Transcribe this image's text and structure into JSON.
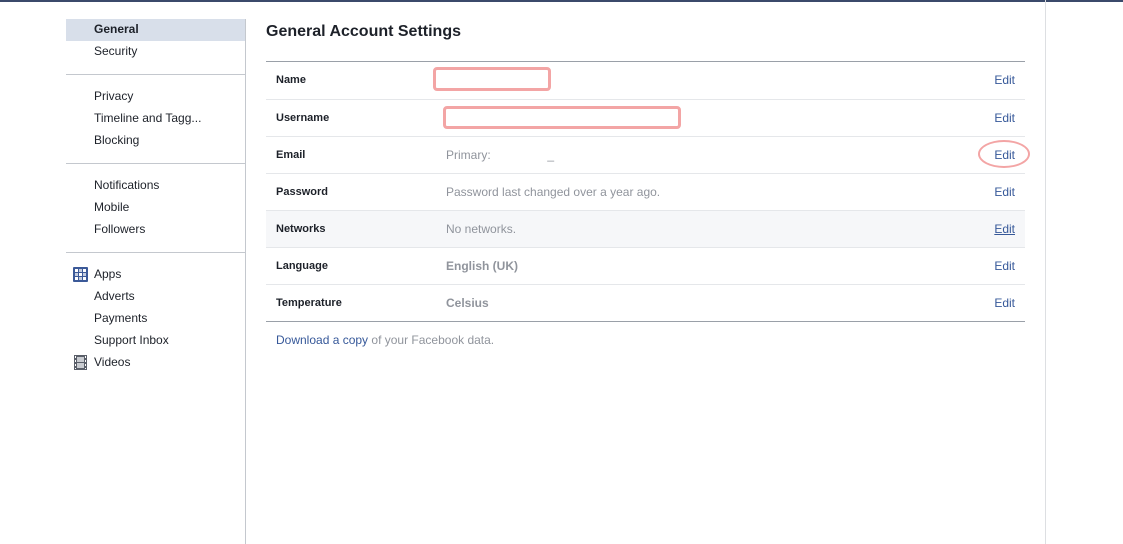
{
  "sidebar": {
    "groups": [
      {
        "items": [
          {
            "label": "General",
            "active": true
          },
          {
            "label": "Security"
          }
        ]
      },
      {
        "items": [
          {
            "label": "Privacy"
          },
          {
            "label": "Timeline and Tagg..."
          },
          {
            "label": "Blocking"
          }
        ]
      },
      {
        "items": [
          {
            "label": "Notifications"
          },
          {
            "label": "Mobile"
          },
          {
            "label": "Followers"
          }
        ]
      },
      {
        "items": [
          {
            "label": "Apps",
            "icon": "apps-icon"
          },
          {
            "label": "Adverts"
          },
          {
            "label": "Payments"
          },
          {
            "label": "Support Inbox"
          },
          {
            "label": "Videos",
            "icon": "film-icon"
          }
        ]
      }
    ]
  },
  "main": {
    "title": "General Account Settings",
    "rows": [
      {
        "label": "Name",
        "value": "",
        "edit": "Edit"
      },
      {
        "label": "Username",
        "value": "",
        "edit": "Edit"
      },
      {
        "label": "Email",
        "value": "Primary:                 _",
        "edit": "Edit"
      },
      {
        "label": "Password",
        "value": "Password last changed over a year ago.",
        "edit": "Edit"
      },
      {
        "label": "Networks",
        "value": "No networks.",
        "edit": "Edit"
      },
      {
        "label": "Language",
        "value": "English (UK)",
        "edit": "Edit"
      },
      {
        "label": "Temperature",
        "value": "Celsius",
        "edit": "Edit"
      }
    ],
    "download": {
      "prefix": "Download a copy",
      "suffix": " of your Facebook data."
    }
  },
  "colors": {
    "link": "#365899",
    "active_bg": "#d8dfea",
    "annotation": "#f3a5a5"
  }
}
